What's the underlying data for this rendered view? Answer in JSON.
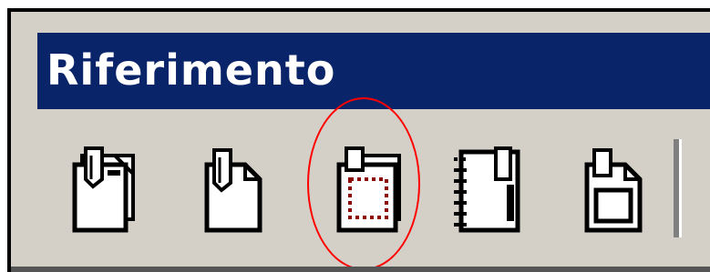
{
  "toolbar_panel": {
    "title": "Riferimento",
    "title_bg_color": "#0a246a",
    "panel_bg_color": "#d4d0c8",
    "buttons": [
      {
        "icon": "insert-footnote-icon"
      },
      {
        "icon": "insert-endnote-icon"
      },
      {
        "icon": "insert-frame-note-icon"
      },
      {
        "icon": "notebook-icon"
      },
      {
        "icon": "note-border-icon"
      }
    ],
    "highlight": {
      "target": "insert-frame-note-icon",
      "color": "#ff0000"
    }
  }
}
